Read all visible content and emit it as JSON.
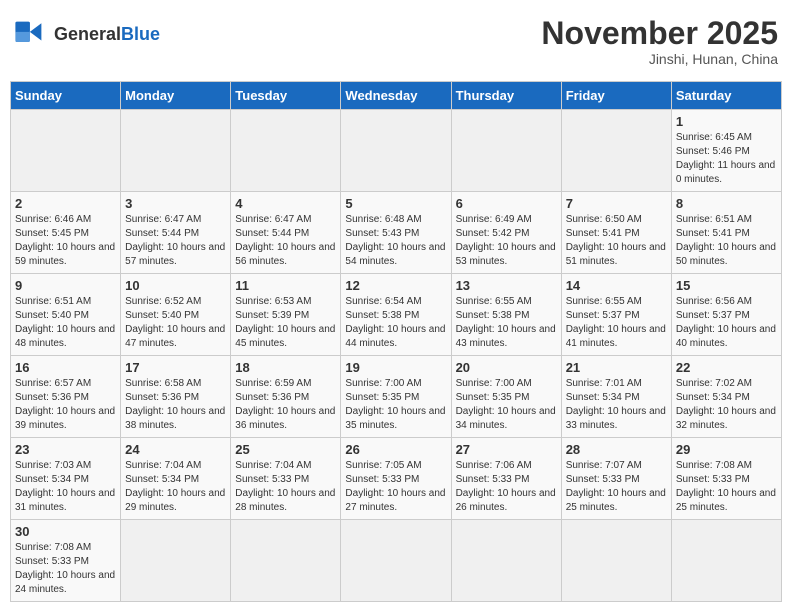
{
  "header": {
    "title": "November 2025",
    "location": "Jinshi, Hunan, China",
    "logo_general": "General",
    "logo_blue": "Blue"
  },
  "days_of_week": [
    "Sunday",
    "Monday",
    "Tuesday",
    "Wednesday",
    "Thursday",
    "Friday",
    "Saturday"
  ],
  "weeks": [
    [
      {
        "day": "",
        "info": ""
      },
      {
        "day": "",
        "info": ""
      },
      {
        "day": "",
        "info": ""
      },
      {
        "day": "",
        "info": ""
      },
      {
        "day": "",
        "info": ""
      },
      {
        "day": "",
        "info": ""
      },
      {
        "day": "1",
        "info": "Sunrise: 6:45 AM\nSunset: 5:46 PM\nDaylight: 11 hours\nand 0 minutes."
      }
    ],
    [
      {
        "day": "2",
        "info": "Sunrise: 6:46 AM\nSunset: 5:45 PM\nDaylight: 10 hours\nand 59 minutes."
      },
      {
        "day": "3",
        "info": "Sunrise: 6:47 AM\nSunset: 5:44 PM\nDaylight: 10 hours\nand 57 minutes."
      },
      {
        "day": "4",
        "info": "Sunrise: 6:47 AM\nSunset: 5:44 PM\nDaylight: 10 hours\nand 56 minutes."
      },
      {
        "day": "5",
        "info": "Sunrise: 6:48 AM\nSunset: 5:43 PM\nDaylight: 10 hours\nand 54 minutes."
      },
      {
        "day": "6",
        "info": "Sunrise: 6:49 AM\nSunset: 5:42 PM\nDaylight: 10 hours\nand 53 minutes."
      },
      {
        "day": "7",
        "info": "Sunrise: 6:50 AM\nSunset: 5:41 PM\nDaylight: 10 hours\nand 51 minutes."
      },
      {
        "day": "8",
        "info": "Sunrise: 6:51 AM\nSunset: 5:41 PM\nDaylight: 10 hours\nand 50 minutes."
      }
    ],
    [
      {
        "day": "9",
        "info": "Sunrise: 6:51 AM\nSunset: 5:40 PM\nDaylight: 10 hours\nand 48 minutes."
      },
      {
        "day": "10",
        "info": "Sunrise: 6:52 AM\nSunset: 5:40 PM\nDaylight: 10 hours\nand 47 minutes."
      },
      {
        "day": "11",
        "info": "Sunrise: 6:53 AM\nSunset: 5:39 PM\nDaylight: 10 hours\nand 45 minutes."
      },
      {
        "day": "12",
        "info": "Sunrise: 6:54 AM\nSunset: 5:38 PM\nDaylight: 10 hours\nand 44 minutes."
      },
      {
        "day": "13",
        "info": "Sunrise: 6:55 AM\nSunset: 5:38 PM\nDaylight: 10 hours\nand 43 minutes."
      },
      {
        "day": "14",
        "info": "Sunrise: 6:55 AM\nSunset: 5:37 PM\nDaylight: 10 hours\nand 41 minutes."
      },
      {
        "day": "15",
        "info": "Sunrise: 6:56 AM\nSunset: 5:37 PM\nDaylight: 10 hours\nand 40 minutes."
      }
    ],
    [
      {
        "day": "16",
        "info": "Sunrise: 6:57 AM\nSunset: 5:36 PM\nDaylight: 10 hours\nand 39 minutes."
      },
      {
        "day": "17",
        "info": "Sunrise: 6:58 AM\nSunset: 5:36 PM\nDaylight: 10 hours\nand 38 minutes."
      },
      {
        "day": "18",
        "info": "Sunrise: 6:59 AM\nSunset: 5:36 PM\nDaylight: 10 hours\nand 36 minutes."
      },
      {
        "day": "19",
        "info": "Sunrise: 7:00 AM\nSunset: 5:35 PM\nDaylight: 10 hours\nand 35 minutes."
      },
      {
        "day": "20",
        "info": "Sunrise: 7:00 AM\nSunset: 5:35 PM\nDaylight: 10 hours\nand 34 minutes."
      },
      {
        "day": "21",
        "info": "Sunrise: 7:01 AM\nSunset: 5:34 PM\nDaylight: 10 hours\nand 33 minutes."
      },
      {
        "day": "22",
        "info": "Sunrise: 7:02 AM\nSunset: 5:34 PM\nDaylight: 10 hours\nand 32 minutes."
      }
    ],
    [
      {
        "day": "23",
        "info": "Sunrise: 7:03 AM\nSunset: 5:34 PM\nDaylight: 10 hours\nand 31 minutes."
      },
      {
        "day": "24",
        "info": "Sunrise: 7:04 AM\nSunset: 5:34 PM\nDaylight: 10 hours\nand 29 minutes."
      },
      {
        "day": "25",
        "info": "Sunrise: 7:04 AM\nSunset: 5:33 PM\nDaylight: 10 hours\nand 28 minutes."
      },
      {
        "day": "26",
        "info": "Sunrise: 7:05 AM\nSunset: 5:33 PM\nDaylight: 10 hours\nand 27 minutes."
      },
      {
        "day": "27",
        "info": "Sunrise: 7:06 AM\nSunset: 5:33 PM\nDaylight: 10 hours\nand 26 minutes."
      },
      {
        "day": "28",
        "info": "Sunrise: 7:07 AM\nSunset: 5:33 PM\nDaylight: 10 hours\nand 25 minutes."
      },
      {
        "day": "29",
        "info": "Sunrise: 7:08 AM\nSunset: 5:33 PM\nDaylight: 10 hours\nand 25 minutes."
      }
    ],
    [
      {
        "day": "30",
        "info": "Sunrise: 7:08 AM\nSunset: 5:33 PM\nDaylight: 10 hours\nand 24 minutes."
      },
      {
        "day": "",
        "info": ""
      },
      {
        "day": "",
        "info": ""
      },
      {
        "day": "",
        "info": ""
      },
      {
        "day": "",
        "info": ""
      },
      {
        "day": "",
        "info": ""
      },
      {
        "day": "",
        "info": ""
      }
    ]
  ]
}
